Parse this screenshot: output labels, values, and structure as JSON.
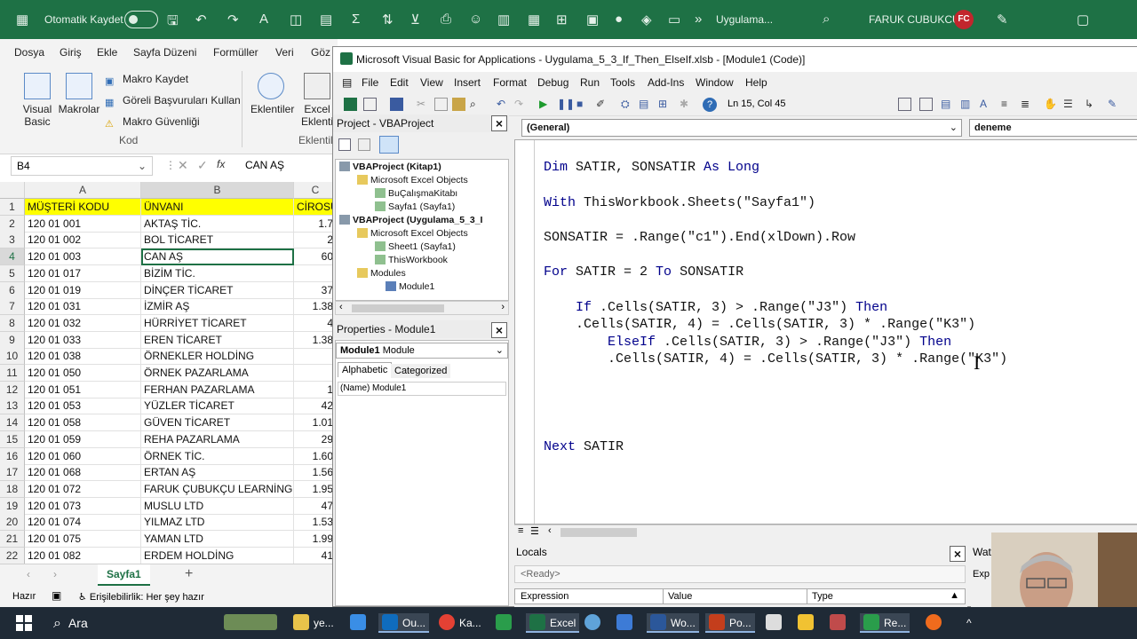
{
  "excel": {
    "autosave_label": "Otomatik Kaydet",
    "doc_title": "Uygulama...",
    "user_name": "FARUK CUBUKCU",
    "user_initials": "FC",
    "menu": [
      "Dosya",
      "Giriş",
      "Ekle",
      "Sayfa Düzeni",
      "Formüller",
      "Veri",
      "Göz"
    ],
    "ribbon": {
      "visual_basic": "Visual Basic",
      "macros": "Makrolar",
      "record_macro": "Makro Kaydet",
      "relative_refs": "Göreli Başvuruları Kullan",
      "macro_security": "Makro Güvenliği",
      "group_code": "Kod",
      "addins": "Eklentiler",
      "excel_addins": "Excel Eklenti",
      "group_addins": "Eklentil"
    },
    "name_box": "B4",
    "formula_value": "CAN AŞ",
    "columns": [
      "A",
      "B",
      "C"
    ],
    "rows": [
      {
        "n": "1",
        "a": "MÜŞTERİ KODU",
        "b": "ÜNVANI",
        "c": "CİROSU"
      },
      {
        "n": "2",
        "a": "120 01 001",
        "b": "AKTAŞ TİC.",
        "c": "1.7"
      },
      {
        "n": "3",
        "a": "120 01 002",
        "b": "BOL TİCARET",
        "c": "2"
      },
      {
        "n": "4",
        "a": "120 01 003",
        "b": "CAN AŞ",
        "c": "60"
      },
      {
        "n": "5",
        "a": "120 01 017",
        "b": "BİZİM TİC.",
        "c": ""
      },
      {
        "n": "6",
        "a": "120 01 019",
        "b": "DİNÇER TİCARET",
        "c": "37"
      },
      {
        "n": "7",
        "a": "120 01 031",
        "b": "İZMİR AŞ",
        "c": "1.38"
      },
      {
        "n": "8",
        "a": "120 01 032",
        "b": "HÜRRİYET TİCARET",
        "c": "4"
      },
      {
        "n": "9",
        "a": "120 01 033",
        "b": "EREN TİCARET",
        "c": "1.38"
      },
      {
        "n": "10",
        "a": "120 01 038",
        "b": "ÖRNEKLER HOLDİNG",
        "c": ""
      },
      {
        "n": "11",
        "a": "120 01 050",
        "b": "ÖRNEK PAZARLAMA",
        "c": ""
      },
      {
        "n": "12",
        "a": "120 01 051",
        "b": "FERHAN PAZARLAMA",
        "c": "1"
      },
      {
        "n": "13",
        "a": "120 01 053",
        "b": "YÜZLER TİCARET",
        "c": "42"
      },
      {
        "n": "14",
        "a": "120 01 058",
        "b": "GÜVEN TİCARET",
        "c": "1.01"
      },
      {
        "n": "15",
        "a": "120 01 059",
        "b": "REHA PAZARLAMA",
        "c": "29"
      },
      {
        "n": "16",
        "a": "120 01 060",
        "b": "ÖRNEK TİC.",
        "c": "1.60"
      },
      {
        "n": "17",
        "a": "120 01 068",
        "b": "ERTAN AŞ",
        "c": "1.56"
      },
      {
        "n": "18",
        "a": "120 01 072",
        "b": "FARUK ÇUBUKÇU LEARNİNG",
        "c": "1.95"
      },
      {
        "n": "19",
        "a": "120 01 073",
        "b": "MUSLU LTD",
        "c": "47"
      },
      {
        "n": "20",
        "a": "120 01 074",
        "b": "YILMAZ LTD",
        "c": "1.53"
      },
      {
        "n": "21",
        "a": "120 01 075",
        "b": "YAMAN LTD",
        "c": "1.99"
      },
      {
        "n": "22",
        "a": "120 01 082",
        "b": "ERDEM HOLDİNG",
        "c": "41"
      }
    ],
    "sheet_tab": "Sayfa1",
    "add_sheet": "+",
    "status_ready": "Hazır",
    "accessibility": "Erişilebilirlik: Her şey hazır"
  },
  "vbe": {
    "title": "Microsoft Visual Basic for Applications - Uygulama_5_3_If_Then_ElseIf.xlsb - [Module1 (Code)]",
    "menu": [
      "File",
      "Edit",
      "View",
      "Insert",
      "Format",
      "Debug",
      "Run",
      "Tools",
      "Add-Ins",
      "Window",
      "Help"
    ],
    "cursor_pos": "Ln 15, Col 45",
    "project_title": "Project - VBAProject",
    "tree": [
      "VBAProject (Kitap1)",
      "Microsoft Excel Objects",
      "BuÇalışmaKitabı",
      "Sayfa1 (Sayfa1)",
      "VBAProject (Uygulama_5_3_I",
      "Microsoft Excel Objects",
      "Sheet1 (Sayfa1)",
      "ThisWorkbook",
      "Modules",
      "Module1"
    ],
    "props_title": "Properties - Module1",
    "props_object": "Module1",
    "props_object_type": "Module",
    "props_tabs": [
      "Alphabetic",
      "Categorized"
    ],
    "props_name_key": "(Name)",
    "props_name_val": "Module1",
    "combo_general": "(General)",
    "combo_proc": "deneme",
    "code": [
      "Dim SATIR, SONSATIR As Long",
      "With ThisWorkbook.Sheets(\"Sayfa1\")",
      "SONSATIR = .Range(\"c1\").End(xlDown).Row",
      "For SATIR = 2 To SONSATIR",
      "    If .Cells(SATIR, 3) > .Range(\"J3\") Then",
      "    .Cells(SATIR, 4) = .Cells(SATIR, 3) * .Range(\"K3\")",
      "        ElseIf .Cells(SATIR, 3) > .Range(\"J3\") Then",
      "        .Cells(SATIR, 4) = .Cells(SATIR, 3) * .Range(\"K3\")",
      "Next SATIR"
    ],
    "locals_title": "Locals",
    "locals_status": "<Ready>",
    "locals_cols": [
      "Expression",
      "Value",
      "Type"
    ],
    "watch_title": "Watc",
    "watch_col": "Exp"
  },
  "taskbar": {
    "search": "Ara",
    "items": [
      "ye...",
      "Ou...",
      "Ka...",
      "Excel",
      "Wo...",
      "Po...",
      "Re..."
    ]
  },
  "colors": {
    "excel_green": "#1e7145",
    "header_yellow": "#ffff00",
    "vba_keyword": "#00008b",
    "taskbar": "#1f2a36"
  }
}
